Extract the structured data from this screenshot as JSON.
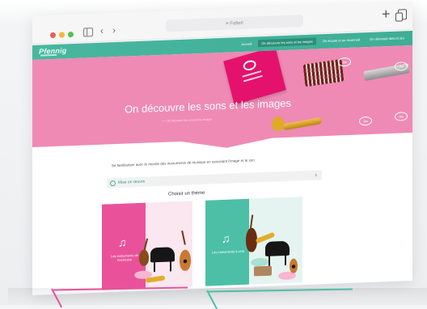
{
  "window": {
    "address_text": "≡ Fafiet!"
  },
  "navbar": {
    "logo_text": "Pfennig",
    "items": [
      {
        "label": "Accueil",
        "active": false
      },
      {
        "label": "On découvre les sons et les images",
        "active": true
      },
      {
        "label": "On écoute et on reconnaît",
        "active": false
      },
      {
        "label": "On réinvestit dans le jeu",
        "active": false
      }
    ]
  },
  "hero": {
    "title": "On découvre les sons et les images",
    "subtitle": "• • • On découvre les sons et les images",
    "badges": [
      "Jeu",
      "Jeu",
      "Jeu",
      "Jeu"
    ]
  },
  "intro_text": "Se familiariser avec le monde des instruments de musique en associant l'image et le son.",
  "resources_label": "Mise en œuvre",
  "theme_heading": "Choisir un thème",
  "themes": [
    {
      "label": "Les instruments de l'orchestre"
    },
    {
      "label": "Les instruments à vent"
    }
  ],
  "colors": {
    "brand_teal": "#3fae96",
    "hero_pink": "#ef8ab4",
    "accent_magenta": "#e9529a"
  },
  "icons": {
    "music_note": "♫",
    "chevron": "›",
    "new_tab": "+"
  }
}
